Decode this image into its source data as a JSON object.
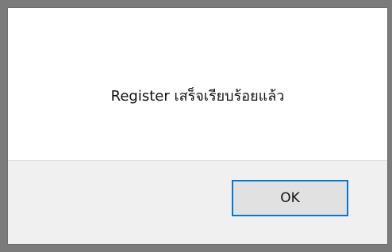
{
  "dialog": {
    "message": "Register เสร็จเรียบร้อยแล้ว",
    "ok_label": "OK"
  },
  "colors": {
    "frame": "#7b7b7b",
    "dialog_background": "#ffffff",
    "button_area_background": "#f0f0f0",
    "button_background": "#e1e1e1",
    "button_focus_border": "#0078d7"
  }
}
